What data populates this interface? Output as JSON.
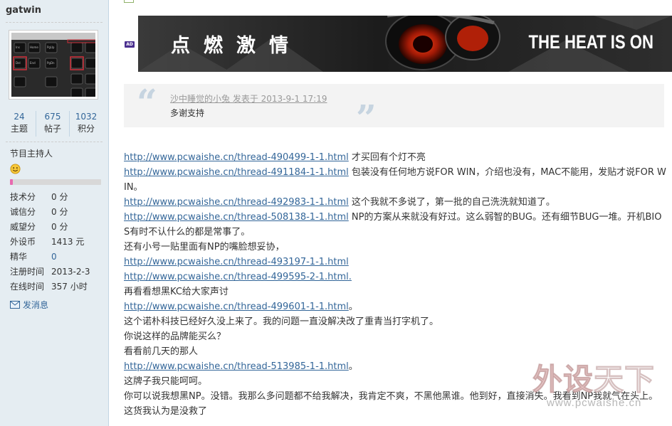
{
  "user": {
    "name": "gatwin",
    "stats": [
      {
        "value": "24",
        "label": "主题"
      },
      {
        "value": "675",
        "label": "帖子"
      },
      {
        "value": "1032",
        "label": "积分"
      }
    ],
    "group_title": "节目主持人",
    "level_progress": 0.03,
    "profile": [
      {
        "label": "技术分",
        "value": "0 分"
      },
      {
        "label": "诚信分",
        "value": "0 分"
      },
      {
        "label": "威望分",
        "value": "0 分"
      },
      {
        "label": "外设币",
        "value": "1413 元"
      },
      {
        "label": "精华",
        "value": "0"
      },
      {
        "label": "注册时间",
        "value": "2013-2-3"
      },
      {
        "label": "在线时间",
        "value": "357 小时"
      }
    ],
    "send_message": "发消息"
  },
  "ad": {
    "badge": "AD",
    "banner_left": "点燃激情",
    "banner_right": "THE HEAT IS ON"
  },
  "quote": {
    "meta": "沙中睡觉的小兔 发表于 2013-9-1 17:19",
    "text": "多谢支持",
    "open_mark": "“",
    "close_mark": "”"
  },
  "post": {
    "lines": [
      {
        "link": "http://www.pcwaishe.cn/thread-490499-1-1.html",
        "text": " 才买回有个灯不亮"
      },
      {
        "link": "http://www.pcwaishe.cn/thread-491184-1-1.html",
        "text": " 包装没有任何地方说FOR WIN，介绍也没有，MAC不能用，发贴才说FOR WIN。"
      },
      {
        "link": "http://www.pcwaishe.cn/thread-492983-1-1.html",
        "text": " 这个我就不多说了，第一批的自己洗洗就知道了。"
      },
      {
        "link": "http://www.pcwaishe.cn/thread-508138-1-1.html",
        "text": " NP的方案从来就没有好过。这么弱智的BUG。还有细节BUG一堆。开机BIOS有时不认什么的都是常事了。"
      },
      {
        "link": "",
        "text": "还有小号一贴里面有NP的嘴脸想妥协，"
      },
      {
        "link": "http://www.pcwaishe.cn/thread-493197-1-1.html",
        "text": ""
      },
      {
        "link": "http://www.pcwaishe.cn/thread-499595-2-1.html.",
        "text": ""
      },
      {
        "link": "",
        "text": "再看看想黑KC给大家声讨"
      },
      {
        "link": "http://www.pcwaishe.cn/thread-499601-1-1.html",
        "text": "。"
      },
      {
        "link": "",
        "text": "这个诺朴科技已经好久没上来了。我的问题一直没解决改了重青当打字机了。"
      },
      {
        "link": "",
        "text": "你说这样的品牌能买么？"
      },
      {
        "link": "",
        "text": "看看前几天的那人"
      },
      {
        "link": "http://www.pcwaishe.cn/thread-513985-1-1.html",
        "text": "。"
      },
      {
        "link": "",
        "text": "这牌子我只能呵呵。"
      },
      {
        "link": "",
        "text": "你可以说我想黑NP。没错。我那么多问题都不给我解决，我肯定不爽，不黑他黑谁。他到好，直接消失。我看到NP我就气在头上。这货我认为是没救了"
      }
    ]
  },
  "watermark": {
    "big_left": "外设",
    "big_right": "天下",
    "url": "www.pcwaishe.cn"
  }
}
